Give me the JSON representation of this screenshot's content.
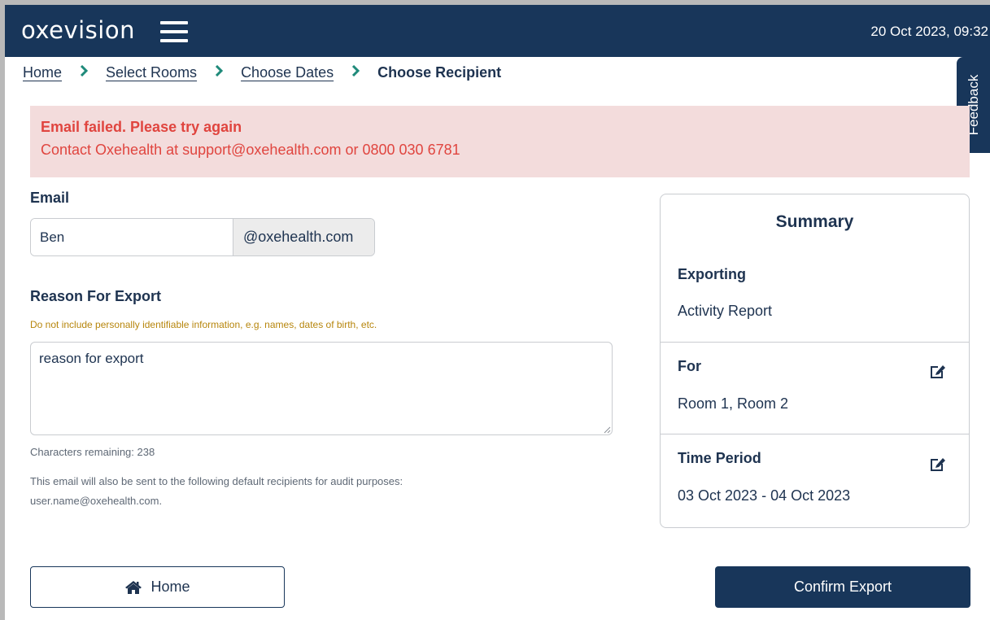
{
  "header": {
    "logo": "oxevision",
    "menu_icon": "hamburger-menu-icon",
    "datetime": "20 Oct 2023, 09:32"
  },
  "breadcrumb": {
    "items": [
      "Home",
      "Select Rooms",
      "Choose Dates"
    ],
    "current": "Choose Recipient",
    "separator_icon": "chevron-right-icon"
  },
  "feedback_tab": {
    "label": "Feedback"
  },
  "alert": {
    "title": "Email failed. Please try again",
    "body": "Contact Oxehealth at support@oxehealth.com or 0800 030 6781",
    "background": "#f3dcdc",
    "text_color": "#e0453f"
  },
  "form": {
    "email_label": "Email",
    "email_value": "Ben",
    "email_suffix": "@oxehealth.com",
    "reason_label": "Reason For Export",
    "reason_warning": "Do not include personally identifiable information, e.g. names, dates of birth, etc.",
    "reason_value": "reason for export",
    "chars_remaining": "Characters remaining: 238",
    "audit_note_line1": "This email will also be sent to the following default recipients for audit purposes:",
    "audit_note_line2": "user.name@oxehealth.com."
  },
  "summary": {
    "title": "Summary",
    "sections": [
      {
        "heading": "Exporting",
        "value": "Activity Report",
        "editable": false
      },
      {
        "heading": "For",
        "value": "Room 1, Room 2",
        "editable": true,
        "icon": "edit-icon"
      },
      {
        "heading": "Time Period",
        "value": "03 Oct 2023 - 04 Oct 2023",
        "editable": true,
        "icon": "edit-icon"
      }
    ]
  },
  "buttons": {
    "home_label": "Home",
    "home_icon": "home-icon",
    "confirm_label": "Confirm Export"
  },
  "colors": {
    "navy": "#18365a",
    "text": "#1e3350",
    "accent_teal": "#1f8a7a",
    "warning": "#b7860d"
  }
}
